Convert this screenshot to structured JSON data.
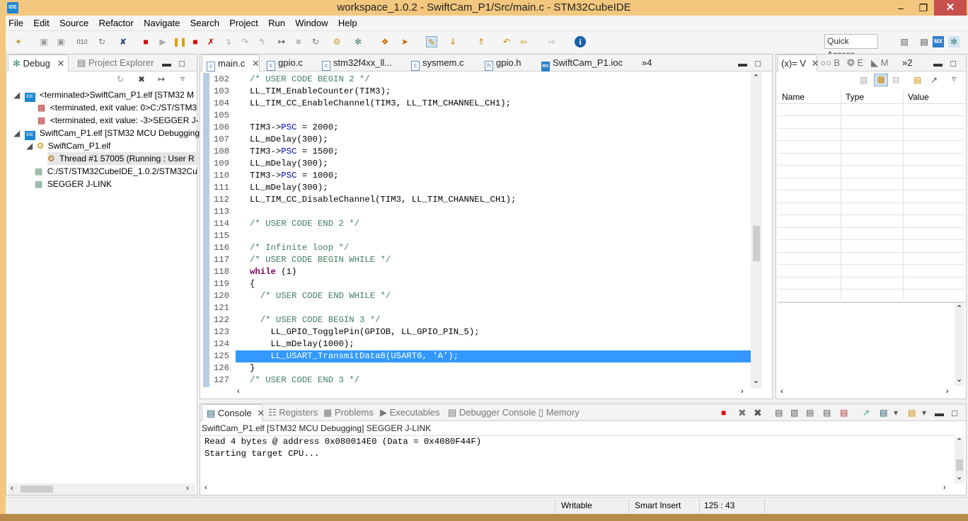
{
  "window": {
    "title": "workspace_1.0.2 - SwiftCam_P1/Src/main.c - STM32CubeIDE",
    "app_icon": "IDE"
  },
  "menu": [
    "File",
    "Edit",
    "Source",
    "Refactor",
    "Navigate",
    "Search",
    "Project",
    "Run",
    "Window",
    "Help"
  ],
  "quick_access": "Quick Access",
  "debug_view": {
    "tabs": [
      "Debug",
      "Project Explorer"
    ],
    "tree": [
      {
        "text": "<terminated>SwiftCam_P1.elf [STM32 M",
        "icon": "ide-icon"
      },
      {
        "text": "<terminated, exit value: 0>C:/ST/STM3",
        "icon": "process-icon"
      },
      {
        "text": "<terminated, exit value: -3>SEGGER J-",
        "icon": "process-icon"
      },
      {
        "text": "SwiftCam_P1.elf [STM32 MCU Debugging",
        "icon": "ide-icon"
      },
      {
        "text": "SwiftCam_P1.elf",
        "icon": "debug-target-icon"
      },
      {
        "text": "Thread #1 57005 (Running : User R",
        "icon": "thread-icon"
      },
      {
        "text": "C:/ST/STM32CubeIDE_1.0.2/STM32Cu",
        "icon": "process-icon"
      },
      {
        "text": "SEGGER J-LINK",
        "icon": "process-icon"
      }
    ]
  },
  "editor": {
    "tabs": [
      "main.c",
      "gpio.c",
      "stm32f4xx_ll...",
      "sysmem.c",
      "gpio.h",
      "SwiftCam_P1.ioc",
      "»4"
    ],
    "lines": [
      {
        "n": "102",
        "code": "/* USER CODE BEGIN 2 */"
      },
      {
        "n": "103",
        "code": "LL_TIM_EnableCounter(TIM3);"
      },
      {
        "n": "104",
        "code": "LL_TIM_CC_EnableChannel(TIM3, LL_TIM_CHANNEL_CH1);"
      },
      {
        "n": "105",
        "code": ""
      },
      {
        "n": "106",
        "code": "TIM3->PSC = 2000;"
      },
      {
        "n": "107",
        "code": "LL_mDelay(300);"
      },
      {
        "n": "108",
        "code": "TIM3->PSC = 1500;"
      },
      {
        "n": "109",
        "code": "LL_mDelay(300);"
      },
      {
        "n": "110",
        "code": "TIM3->PSC = 1000;"
      },
      {
        "n": "111",
        "code": "LL_mDelay(300);"
      },
      {
        "n": "112",
        "code": "LL_TIM_CC_DisableChannel(TIM3, LL_TIM_CHANNEL_CH1);"
      },
      {
        "n": "113",
        "code": ""
      },
      {
        "n": "114",
        "code": "/* USER CODE END 2 */"
      },
      {
        "n": "115",
        "code": ""
      },
      {
        "n": "116",
        "code": "/* Infinite loop */"
      },
      {
        "n": "117",
        "code": "/* USER CODE BEGIN WHILE */"
      },
      {
        "n": "118",
        "code": "while (1)"
      },
      {
        "n": "119",
        "code": "{"
      },
      {
        "n": "120",
        "code": "  /* USER CODE END WHILE */"
      },
      {
        "n": "121",
        "code": ""
      },
      {
        "n": "122",
        "code": "  /* USER CODE BEGIN 3 */"
      },
      {
        "n": "123",
        "code": "    LL_GPIO_TogglePin(GPIOB, LL_GPIO_PIN_5);"
      },
      {
        "n": "124",
        "code": "    LL_mDelay(1000);"
      },
      {
        "n": "125",
        "code": "    LL_USART_TransmitData8(USART6, 'A');"
      },
      {
        "n": "126",
        "code": "}"
      },
      {
        "n": "127",
        "code": "/* USER CODE END 3 */"
      }
    ],
    "highlighted_line": "125"
  },
  "variables_view": {
    "tabs": [
      "(x)= V",
      "B",
      "E",
      "M",
      "»2"
    ],
    "columns": [
      "Name",
      "Type",
      "Value"
    ]
  },
  "console": {
    "tabs": [
      "Console",
      "Registers",
      "Problems",
      "Executables",
      "Debugger Console",
      "Memory"
    ],
    "header": "SwiftCam_P1.elf [STM32 MCU Debugging] SEGGER J-LINK",
    "lines": [
      "Read 4 bytes @ address 0x080014E0 (Data = 0x4080F44F)",
      "Starting target CPU..."
    ]
  },
  "status": {
    "mode": "Writable",
    "insert": "Smart Insert",
    "position": "125 : 43"
  }
}
